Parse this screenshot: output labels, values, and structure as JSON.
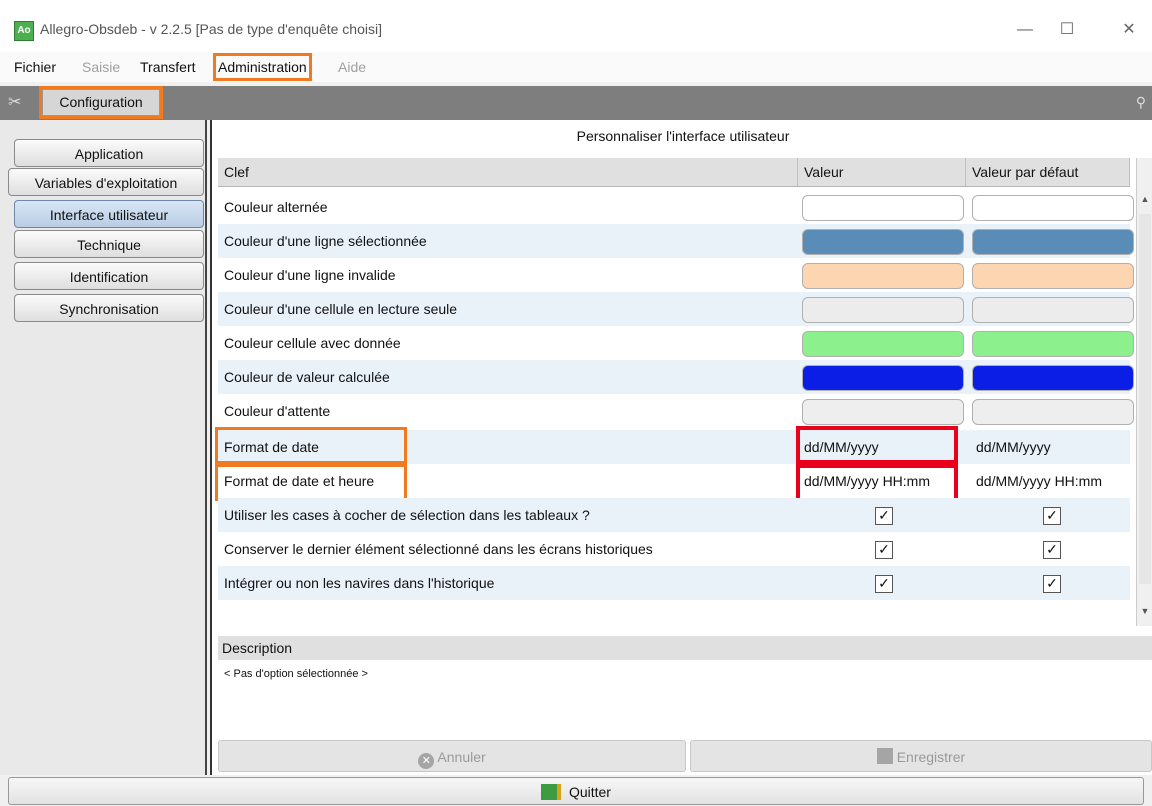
{
  "window": {
    "app_icon": "allegro-icon",
    "title": "Allegro-Obsdeb - v 2.2.5 [Pas de type d'enquête choisi]"
  },
  "menu": [
    {
      "label": "Fichier",
      "enabled": true
    },
    {
      "label": "Saisie",
      "enabled": false
    },
    {
      "label": "Transfert",
      "enabled": true
    },
    {
      "label": "Administration",
      "enabled": true
    },
    {
      "label": "Aide",
      "enabled": false
    }
  ],
  "config_bar": {
    "label": "Configuration"
  },
  "sidebar": {
    "items": [
      {
        "label": "Application"
      },
      {
        "label": "Variables d'exploitation"
      },
      {
        "label": "Interface utilisateur"
      },
      {
        "label": "Technique"
      },
      {
        "label": "Identification"
      },
      {
        "label": "Synchronisation"
      }
    ]
  },
  "panel": {
    "title": "Personnaliser l'interface utilisateur",
    "columns": {
      "key": "Clef",
      "value": "Valeur",
      "default": "Valeur par défaut"
    },
    "rows": [
      {
        "key": "Couleur alternée",
        "value_color": "#ffffff",
        "default_color": "#ffffff"
      },
      {
        "key": "Couleur d'une ligne sélectionnée",
        "value_color": "#5a8cb8",
        "default_color": "#5a8cb8"
      },
      {
        "key": "Couleur d'une ligne invalide",
        "value_color": "#fdd5b1",
        "default_color": "#fdd5b1"
      },
      {
        "key": "Couleur d'une cellule en lecture seule",
        "value_color": "#ececec",
        "default_color": "#ececec"
      },
      {
        "key": "Couleur cellule avec donnée",
        "value_color": "#8cf08c",
        "default_color": "#8cf08c"
      },
      {
        "key": "Couleur de valeur calculée",
        "value_color": "#0a1ee6",
        "default_color": "#0a1ee6"
      },
      {
        "key": "Couleur d'attente",
        "value_color": "#eeeeee",
        "default_color": "#eeeeee"
      },
      {
        "key": "Format de date",
        "value": "dd/MM/yyyy",
        "default": "dd/MM/yyyy"
      },
      {
        "key": "Format de date et heure",
        "value": "dd/MM/yyyy HH:mm",
        "default": "dd/MM/yyyy HH:mm"
      },
      {
        "key": "Utiliser les cases à cocher de sélection dans les tableaux ?",
        "value_checked": "✓",
        "default_checked": "✓"
      },
      {
        "key": "Conserver le dernier élément sélectionné dans les écrans historiques",
        "value_checked": "✓",
        "default_checked": "✓"
      },
      {
        "key": "Intégrer ou non les navires dans l'historique",
        "value_checked": "✓",
        "default_checked": "✓"
      }
    ]
  },
  "description": {
    "header": "Description",
    "text": "< Pas d'option sélectionnée >"
  },
  "actions": {
    "cancel": "Annuler",
    "save": "Enregistrer"
  },
  "quit": {
    "label": "Quitter"
  }
}
